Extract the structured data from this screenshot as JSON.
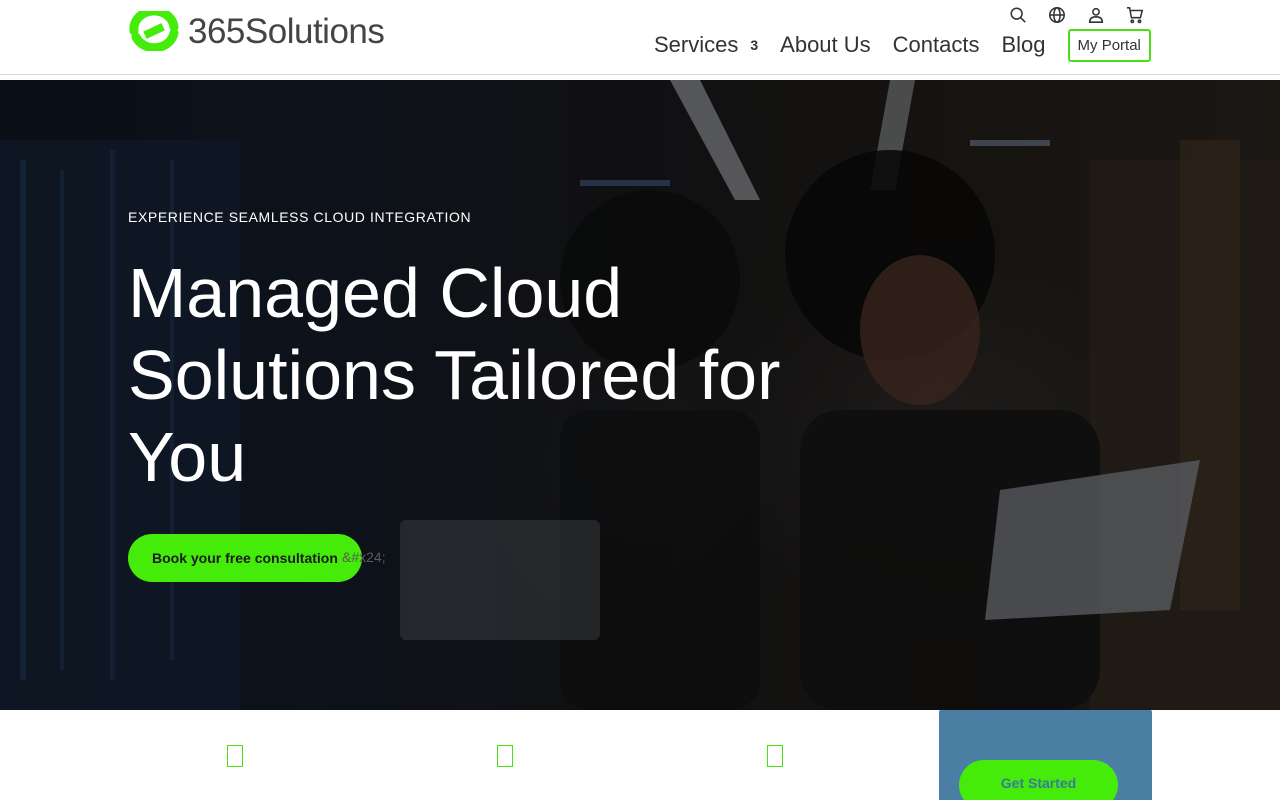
{
  "brand": {
    "name": "365Solutions",
    "accent": "#45ec0a",
    "card_color": "#4a7fa3"
  },
  "utility_icons": [
    "search-icon",
    "globe-icon",
    "user-icon",
    "cart-icon"
  ],
  "nav": {
    "services_label": "Services",
    "services_caret": "3",
    "about_label": "About Us",
    "contacts_label": "Contacts",
    "blog_label": "Blog",
    "portal_label": "My Portal"
  },
  "hero": {
    "eyebrow": "EXPERIENCE SEAMLESS CLOUD INTEGRATION",
    "headline": "Managed Cloud Solutions Tailored for You",
    "cta_label": "Book your free consultation",
    "cta_suffix": "&#x24;"
  },
  "side_card": {
    "cta_label": "Get Started"
  }
}
